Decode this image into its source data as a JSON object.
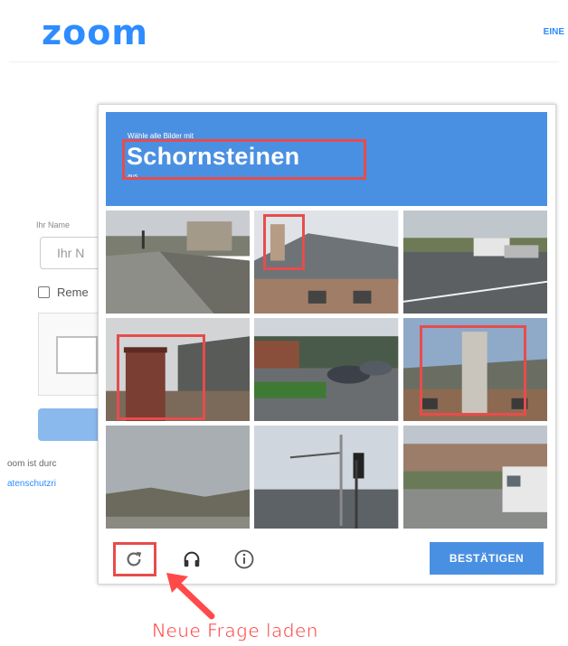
{
  "header": {
    "logo": "zoom",
    "nav_text": "EINE"
  },
  "form": {
    "name_label": "Ihr Name",
    "name_value": "Ihr N",
    "remember_label": "Reme",
    "footer_text": "oom ist durc",
    "footer_link": "atenschutzri"
  },
  "captcha": {
    "instruction_pre": "Wähle alle Bilder mit",
    "instruction_target": "Schornsteinen",
    "instruction_post": "aus",
    "selected_tiles": [
      1,
      3,
      5
    ],
    "toolbar": {
      "reload_icon": "reload-icon",
      "audio_icon": "headphones-icon",
      "info_icon": "info-icon",
      "verify_label": "BESTÄTIGEN"
    }
  },
  "annotation": {
    "label": "Neue Frage laden",
    "color": "#ff4a4a"
  },
  "colors": {
    "brand": "#2d8cff",
    "captcha_blue": "#4a90e2",
    "highlight": "#e74c4c"
  }
}
